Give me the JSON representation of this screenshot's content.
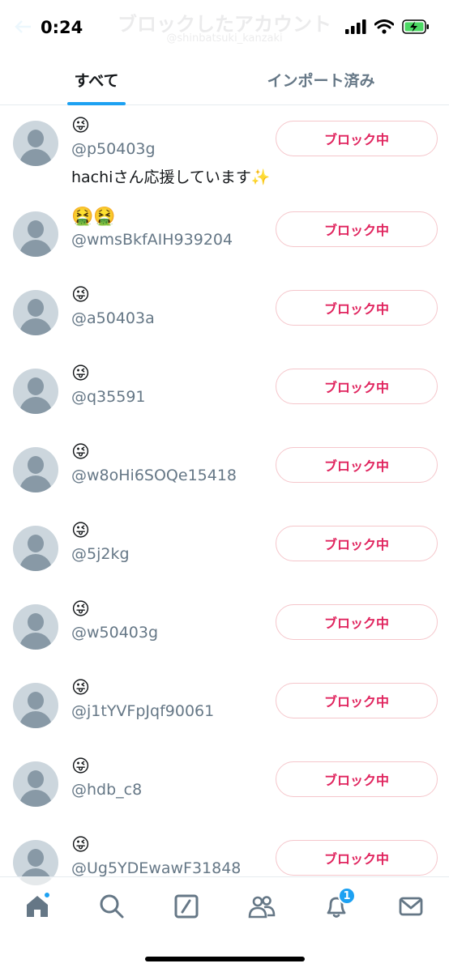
{
  "status": {
    "time": "0:24"
  },
  "header": {
    "title": "ブロックしたアカウント",
    "subtitle": "@shinbatsuki_kanzaki"
  },
  "tabs": [
    {
      "label": "すべて",
      "active": true
    },
    {
      "label": "インポート済み",
      "active": false
    }
  ],
  "accounts": [
    {
      "name": "😜",
      "handle": "@p50403g",
      "bio": "hachiさん応援しています✨",
      "button": "ブロック中"
    },
    {
      "name": "🤮🤮",
      "handle": "@wmsBkfAIH939204",
      "bio": "",
      "button": "ブロック中"
    },
    {
      "name": "😜",
      "handle": "@a50403a",
      "bio": "",
      "button": "ブロック中"
    },
    {
      "name": "😜",
      "handle": "@q35591",
      "bio": "",
      "button": "ブロック中"
    },
    {
      "name": "😜",
      "handle": "@w8oHi6SOQe15418",
      "bio": "",
      "button": "ブロック中"
    },
    {
      "name": "😜",
      "handle": "@5j2kg",
      "bio": "",
      "button": "ブロック中"
    },
    {
      "name": "😜",
      "handle": "@w50403g",
      "bio": "",
      "button": "ブロック中"
    },
    {
      "name": "😜",
      "handle": "@j1tYVFpJqf90061",
      "bio": "",
      "button": "ブロック中"
    },
    {
      "name": "😜",
      "handle": "@hdb_c8",
      "bio": "",
      "button": "ブロック中"
    },
    {
      "name": "😜",
      "handle": "@Ug5YDEwawF31848",
      "bio": "",
      "button": "ブロック中"
    }
  ],
  "tabbar": {
    "items": [
      "home-icon",
      "search-icon",
      "compose-icon",
      "communities-icon",
      "bell-icon",
      "mail-icon"
    ],
    "notification_count": "1"
  },
  "colors": {
    "accent": "#1da1f2",
    "block_red": "#e0245e",
    "secondary_text": "#657786"
  }
}
